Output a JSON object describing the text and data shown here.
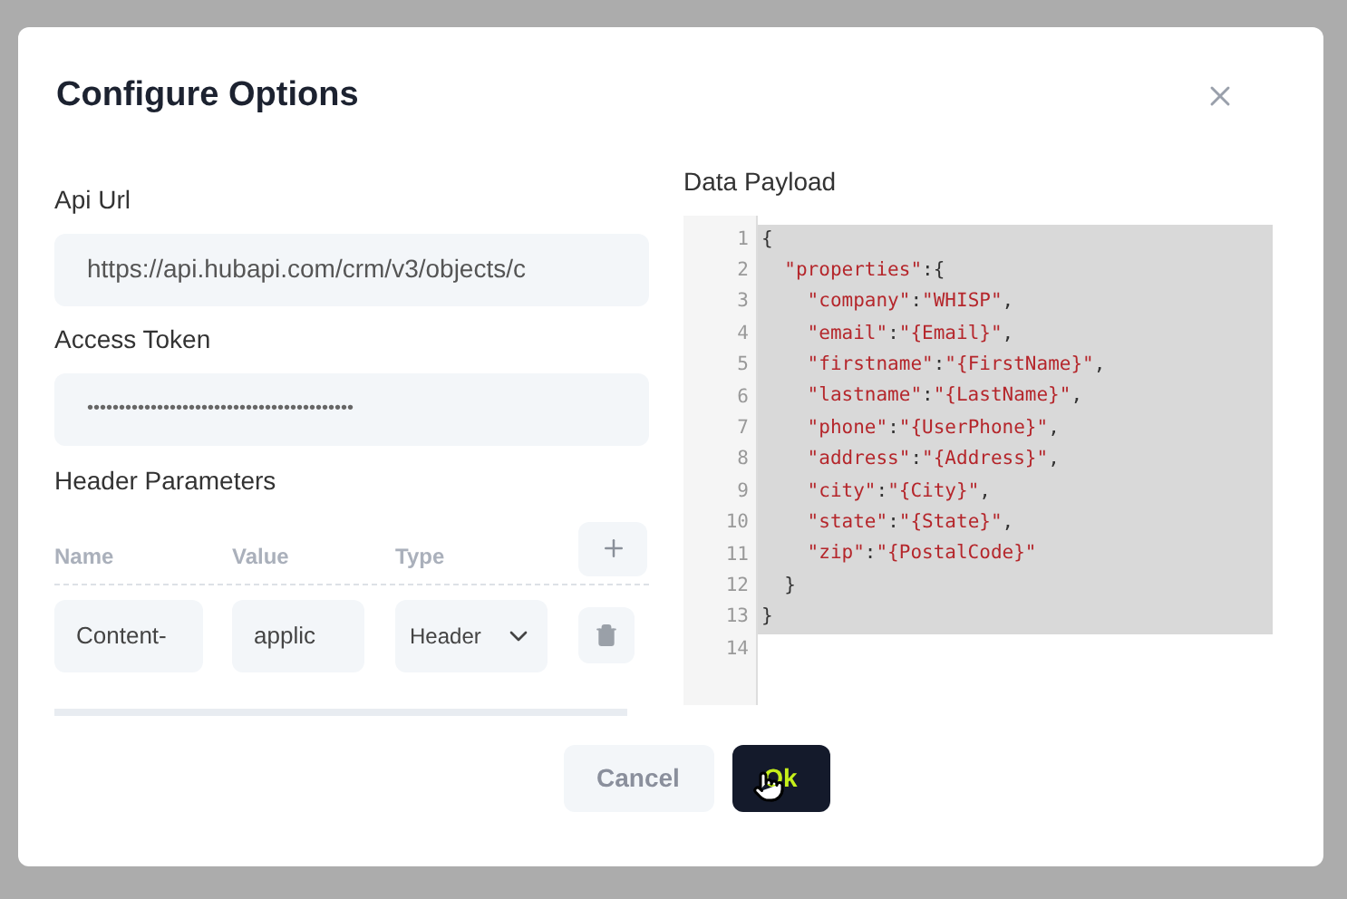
{
  "dialog": {
    "title": "Configure Options"
  },
  "api_url": {
    "label": "Api Url",
    "value": "https://api.hubapi.com/crm/v3/objects/c"
  },
  "access_token": {
    "label": "Access Token",
    "value": "••••••••••••••••••••••••••••••••••••••••••"
  },
  "header_parameters": {
    "label": "Header Parameters",
    "columns": [
      "Name",
      "Value",
      "Type"
    ],
    "rows": [
      {
        "name": "Content-",
        "value": "applic",
        "type": "Header"
      }
    ]
  },
  "payload": {
    "label": "Data Payload",
    "lines": [
      {
        "number": "1",
        "code": "{",
        "selected": true
      },
      {
        "number": "2",
        "code": "  \"properties\":{",
        "selected": true
      },
      {
        "number": "3",
        "code": "    \"company\":\"WHISP\",",
        "selected": true
      },
      {
        "number": "4",
        "code": "    \"email\":\"{Email}\",",
        "selected": true
      },
      {
        "number": "5",
        "code": "    \"firstname\":\"{FirstName}\",",
        "selected": true
      },
      {
        "number": "6",
        "code": "    \"lastname\":\"{LastName}\",",
        "selected": true
      },
      {
        "number": "7",
        "code": "    \"phone\":\"{UserPhone}\",",
        "selected": true
      },
      {
        "number": "8",
        "code": "    \"address\":\"{Address}\",",
        "selected": true
      },
      {
        "number": "9",
        "code": "    \"city\":\"{City}\",",
        "selected": true
      },
      {
        "number": "10",
        "code": "    \"state\":\"{State}\",",
        "selected": true
      },
      {
        "number": "11",
        "code": "    \"zip\":\"{PostalCode}\"",
        "selected": true
      },
      {
        "number": "12",
        "code": "  }",
        "selected": true
      },
      {
        "number": "13",
        "code": "}",
        "selected": true
      },
      {
        "number": "14",
        "selected": false
      }
    ]
  },
  "buttons": [
    {
      "label": "Cancel",
      "kind": "secondary"
    },
    {
      "label": "Ok",
      "kind": "primary"
    }
  ]
}
